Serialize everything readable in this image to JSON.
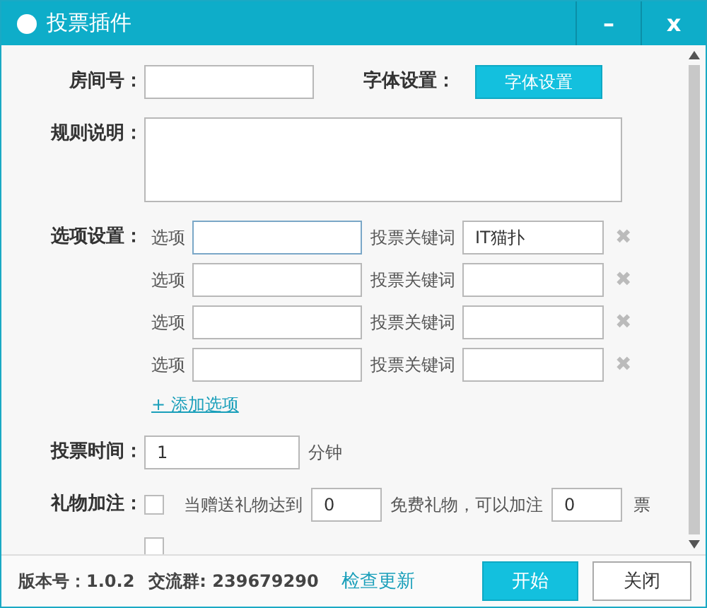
{
  "window": {
    "title": "投票插件",
    "buttons": [
      "–",
      "x"
    ]
  },
  "room": {
    "label": "房间号："
  },
  "font": {
    "label": "字体设置：",
    "button": "字体设置"
  },
  "rules": {
    "label": "规则说明："
  },
  "options": {
    "label": "选项设置：",
    "items": [
      {
        "option_label": "选项",
        "focused": true,
        "keyword_label": "投票关键词",
        "keyword_value": "IT猫扑",
        "remove": "✖"
      },
      {
        "option_label": "选项",
        "focused": false,
        "keyword_label": "投票关键词",
        "remove": "✖"
      },
      {
        "option_label": "选项",
        "focused": false,
        "keyword_label": "投票关键词",
        "remove": "✖"
      },
      {
        "option_label": "选项",
        "focused": false,
        "keyword_label": "投票关键词",
        "remove": "✖"
      }
    ],
    "add": "+ 添加选项"
  },
  "duration": {
    "label": "投票时间：",
    "value": "1",
    "unit": "分钟"
  },
  "gifts": {
    "label": "礼物加注：",
    "rows": [
      {
        "checked": false,
        "before": "当赠送礼物达到",
        "count": "0",
        "middle": "免费礼物，可以加注",
        "votes": "0",
        "after": "票"
      },
      {
        "checked": false
      }
    ]
  },
  "footer": {
    "version": "版本号：1.0.2",
    "group": "交流群: 239679290",
    "update": "检查更新",
    "start": "开始",
    "close": "关闭"
  }
}
